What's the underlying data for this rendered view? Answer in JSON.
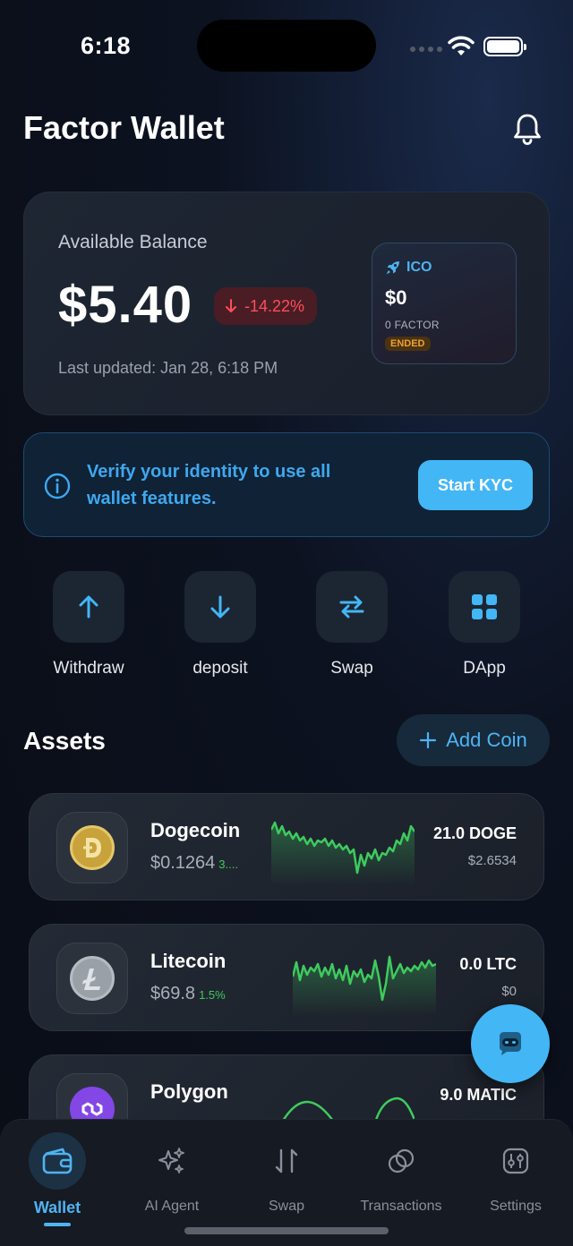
{
  "status_bar": {
    "time": "6:18"
  },
  "header": {
    "title": "Factor Wallet"
  },
  "balance": {
    "label": "Available Balance",
    "value": "$5.40",
    "change": "-14.22%",
    "last_updated": "Last updated: Jan 28, 6:18 PM"
  },
  "ico": {
    "label": "ICO",
    "value": "$0",
    "factor": "0 FACTOR",
    "status": "ENDED"
  },
  "kyc": {
    "message": "Verify your identity to use all wallet features.",
    "button": "Start KYC"
  },
  "actions": [
    {
      "label": "Withdraw",
      "icon": "arrow-up-icon"
    },
    {
      "label": "deposit",
      "icon": "arrow-down-icon"
    },
    {
      "label": "Swap",
      "icon": "swap-icon"
    },
    {
      "label": "DApp",
      "icon": "grid-icon"
    }
  ],
  "assets": {
    "title": "Assets",
    "add_coin": "Add Coin",
    "items": [
      {
        "name": "Dogecoin",
        "price": "$0.1264",
        "change": "3....",
        "amount": "21.0 DOGE",
        "value": "$2.6534",
        "icon": "dogecoin-icon"
      },
      {
        "name": "Litecoin",
        "price": "$69.8",
        "change": "1.5%",
        "amount": "0.0 LTC",
        "value": "$0",
        "icon": "litecoin-icon"
      },
      {
        "name": "Polygon",
        "price": "",
        "change": "",
        "amount": "9.0 MATIC",
        "value": "",
        "icon": "polygon-icon"
      }
    ]
  },
  "nav": [
    {
      "label": "Wallet",
      "icon": "wallet-icon",
      "active": true
    },
    {
      "label": "AI Agent",
      "icon": "sparkles-icon",
      "active": false
    },
    {
      "label": "Swap",
      "icon": "swap-vertical-icon",
      "active": false
    },
    {
      "label": "Transactions",
      "icon": "coins-icon",
      "active": false
    },
    {
      "label": "Settings",
      "icon": "settings-sliders-icon",
      "active": false
    }
  ],
  "colors": {
    "accent": "#43b6f5",
    "negative": "#ff4d5a",
    "positive": "#3ecb5e",
    "warning": "#f0a030"
  }
}
